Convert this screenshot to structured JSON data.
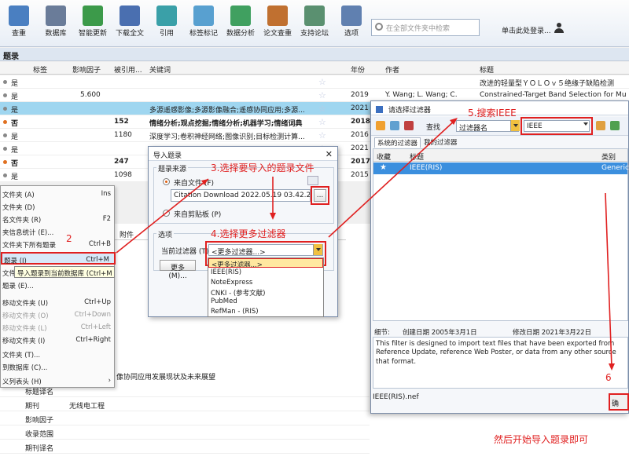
{
  "toolbar": {
    "buttons": [
      {
        "label": "查重",
        "color": "#4a7fc1"
      },
      {
        "label": "数据库",
        "color": "#6a7c99"
      },
      {
        "label": "智能更新",
        "color": "#3c9a4a"
      },
      {
        "label": "下载全文",
        "color": "#4a6fb0"
      },
      {
        "label": "引用",
        "color": "#3aa0a8"
      },
      {
        "label": "标签标记",
        "color": "#58a0d0"
      },
      {
        "label": "数据分析",
        "color": "#40a060"
      },
      {
        "label": "论文查重",
        "color": "#c07030"
      },
      {
        "label": "支持论坛",
        "color": "#5a9070"
      },
      {
        "label": "选项",
        "color": "#6080b0"
      }
    ],
    "search_placeholder": "在全部文件夹中检索",
    "login": "单击此处登录..."
  },
  "section_title": "题录",
  "table": {
    "headers": {
      "tag": "标签",
      "impact": "影响因子",
      "cited": "被引用...",
      "keywords": "关键词",
      "year": "年份",
      "author": "作者",
      "title": "标题"
    },
    "rows": [
      {
        "status": "是",
        "impact": "",
        "cited": "",
        "keywords": "",
        "year": "",
        "author": "",
        "title": "改进的轻量型ＹＯＬＯｖ５绝缘子缺陷检测",
        "bold": false
      },
      {
        "status": "是",
        "impact": "5.600",
        "cited": "",
        "keywords": "",
        "year": "2019",
        "author": "Y. Wang; L. Wang; C.",
        "title": "Constrained-Target Band Selection for Mu",
        "bold": false
      },
      {
        "status": "是",
        "impact": "",
        "cited": "",
        "keywords": "多源遥感影像;多源影像融合;遥感协同应用;多源...",
        "year": "2021",
        "author": "",
        "title": "",
        "bold": false
      },
      {
        "status": "否",
        "impact": "",
        "cited": "152",
        "keywords": "情绪分析;观点挖掘;情绪分析;机器学习;情绪词典",
        "year": "2018",
        "author": "",
        "title": "",
        "bold": true
      },
      {
        "status": "是",
        "impact": "",
        "cited": "1180",
        "keywords": "深度学习;卷积神经网络;图像识别;目标检测计算...",
        "year": "2016",
        "author": "",
        "title": "",
        "bold": false
      },
      {
        "status": "是",
        "impact": "",
        "cited": "",
        "keywords": "",
        "year": "2021",
        "author": "",
        "title": "",
        "bold": false
      },
      {
        "status": "否",
        "impact": "",
        "cited": "247",
        "keywords": "",
        "year": "2017",
        "author": "",
        "title": "",
        "bold": true
      },
      {
        "status": "是",
        "impact": "",
        "cited": "1098",
        "keywords": "",
        "year": "2015",
        "author": "",
        "title": "",
        "bold": false
      }
    ]
  },
  "context_menu": [
    {
      "label": "文件夹 (A)",
      "key": "Ins",
      "disabled": false
    },
    {
      "label": "文件夹 (D)",
      "key": "",
      "disabled": false
    },
    {
      "label": "名文件夹 (R)",
      "key": "F2",
      "disabled": false
    },
    {
      "label": "夹信息统计 (E)...",
      "key": "",
      "disabled": false
    },
    {
      "label": "文件夹下所有题录",
      "key": "Ctrl+B",
      "disabled": false
    },
    {
      "label": "题录 (I)",
      "key": "Ctrl+M",
      "disabled": false
    },
    {
      "label": "文件",
      "key": "",
      "disabled": false
    },
    {
      "label": "题录 (E)...",
      "key": "",
      "disabled": false
    },
    {
      "label": "移动文件夹 (U)",
      "key": "Ctrl+Up",
      "disabled": false
    },
    {
      "label": "移动文件夹 (O)",
      "key": "Ctrl+Down",
      "disabled": true
    },
    {
      "label": "移动文件夹 (L)",
      "key": "Ctrl+Left",
      "disabled": true
    },
    {
      "label": "移动文件夹 (I)",
      "key": "Ctrl+Right",
      "disabled": false
    },
    {
      "label": "文件夹 (T)...",
      "key": "",
      "disabled": false
    },
    {
      "label": "到数据库 (C)...",
      "key": "",
      "disabled": false
    },
    {
      "label": "义列表头 (H)",
      "key": "›",
      "disabled": false
    }
  ],
  "tooltip": "导入题录到当前数据库 (Ctrl+M",
  "details": {
    "tab": "附件",
    "abstract_line": "像协同应用发展现状及未来展望",
    "fields": [
      {
        "label": "标题译名",
        "value": ""
      },
      {
        "label": "期刊",
        "value": "无线电工程"
      },
      {
        "label": "影响因子",
        "value": ""
      },
      {
        "label": "收录范围",
        "value": ""
      },
      {
        "label": "期刊译名",
        "value": ""
      }
    ]
  },
  "import_dialog": {
    "title": "导入题录",
    "source_group": "题录来源",
    "from_file": "来自文件 (F)",
    "file_path": "Citation Download 2022.05.19 03.42.25.ris",
    "browse": "...",
    "from_clipboard": "来自剪贴板 (P)",
    "options_group": "选项",
    "filter_label": "当前过滤器 (T)",
    "filter_value": "<更多过滤器...>",
    "more_button": "更多 (M)...",
    "filter_options": [
      "<更多过滤器...>",
      "IEEE(RIS)",
      "NoteExpress",
      "CNKI - (参考文献)",
      "PubMed",
      "RefMan - (RIS)"
    ]
  },
  "filter_dialog": {
    "title": "请选择过滤器",
    "find_label": "查找",
    "find_field": "过滤器名",
    "find_value": "IEEE",
    "tabs": [
      "系统的过滤器",
      "我的过滤器"
    ],
    "col_fav": "收藏",
    "col_title": "标题",
    "col_type": "类别",
    "row_title": "IEEE(RIS)",
    "row_type": "Generic",
    "detail_label": "细节:",
    "created": "创建日期 2005年3月1日",
    "modified": "修改日期 2021年3月22日",
    "description": "This filter is designed to import text files that have been exported from Reference Update, reference Web Poster, or data from any other source that format.",
    "filename": "IEEE(RIS).nef",
    "ok": "确"
  },
  "annotations": {
    "a2": "2",
    "a3": "3.选择要导入的题录文件",
    "a4": "4.选择更多过滤器",
    "a5": "5.搜索IEEE",
    "a6": "6",
    "final": "然后开始导入题录即可"
  },
  "colors": {
    "annotation": "#e02020",
    "selection": "#9fd6f0",
    "filter_selection": "#3b8fde"
  }
}
